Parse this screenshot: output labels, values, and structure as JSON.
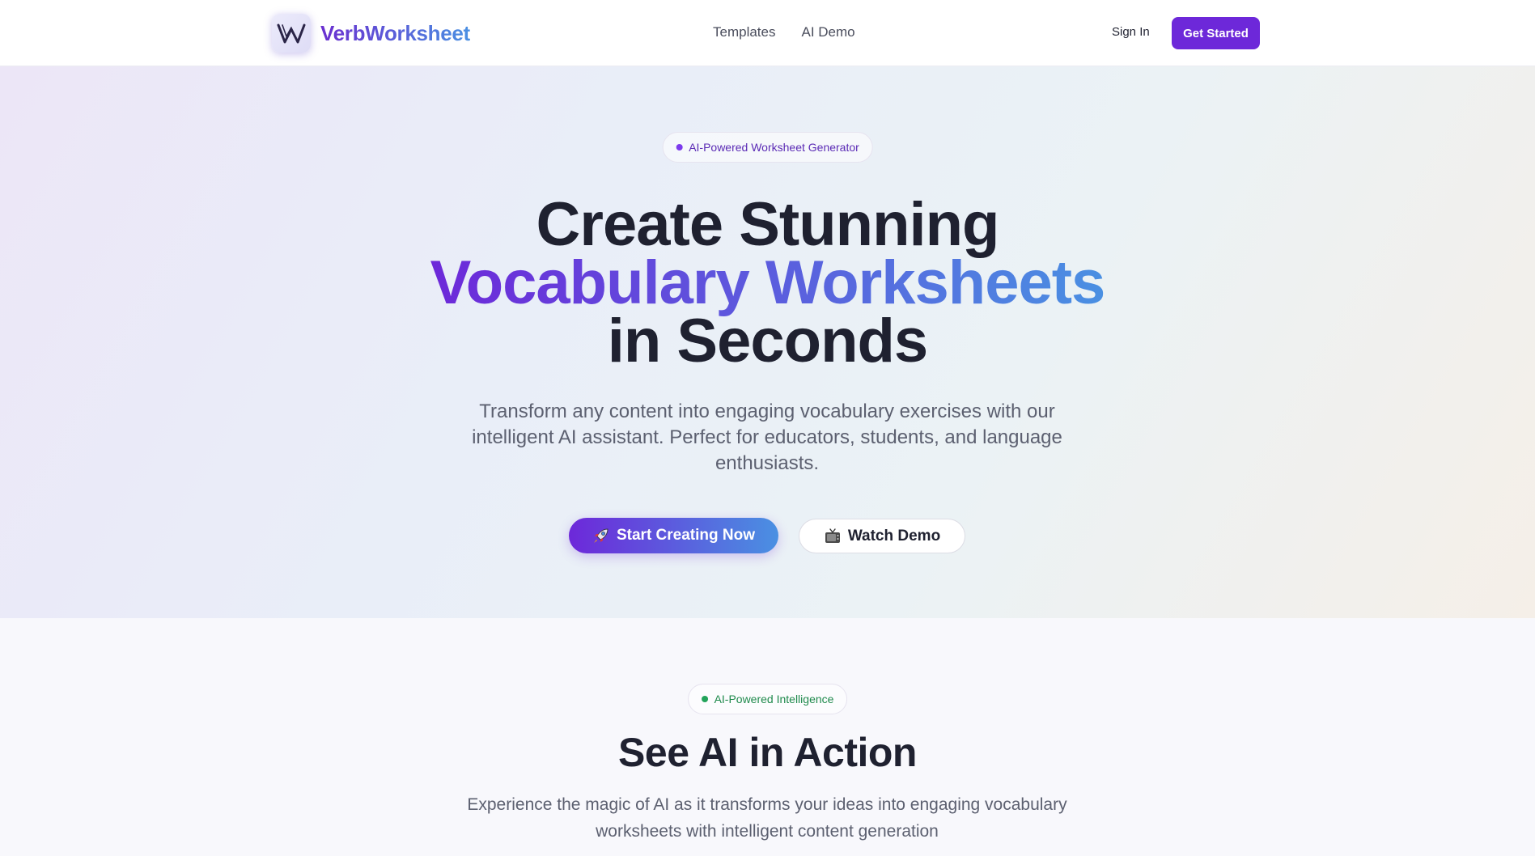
{
  "brand": {
    "name": "VerbWorksheet",
    "logo_icon": "w-monogram-icon",
    "colors": {
      "primary": "#6d28d9",
      "gradient_start": "#6d28d9",
      "gradient_end": "#4a90e2"
    }
  },
  "nav": {
    "links": [
      {
        "label": "Templates"
      },
      {
        "label": "AI Demo"
      }
    ],
    "sign_in": "Sign In",
    "get_started": "Get Started"
  },
  "hero": {
    "badge": "AI-Powered Worksheet Generator",
    "headline_line1": "Create Stunning",
    "headline_highlight": "Vocabulary Worksheets",
    "headline_line3": "in Seconds",
    "subtitle": "Transform any content into engaging vocabulary exercises with our intelligent AI assistant. Perfect for educators, students, and language enthusiasts.",
    "primary_cta": {
      "label": "Start Creating Now",
      "icon": "rocket-icon"
    },
    "secondary_cta": {
      "label": "Watch Demo",
      "icon": "tv-icon"
    }
  },
  "ai_section": {
    "badge": "AI-Powered Intelligence",
    "badge_color": "#22a35a",
    "title": "See AI in Action",
    "subtitle": "Experience the magic of AI as it transforms your ideas into engaging vocabulary worksheets with intelligent content generation"
  }
}
